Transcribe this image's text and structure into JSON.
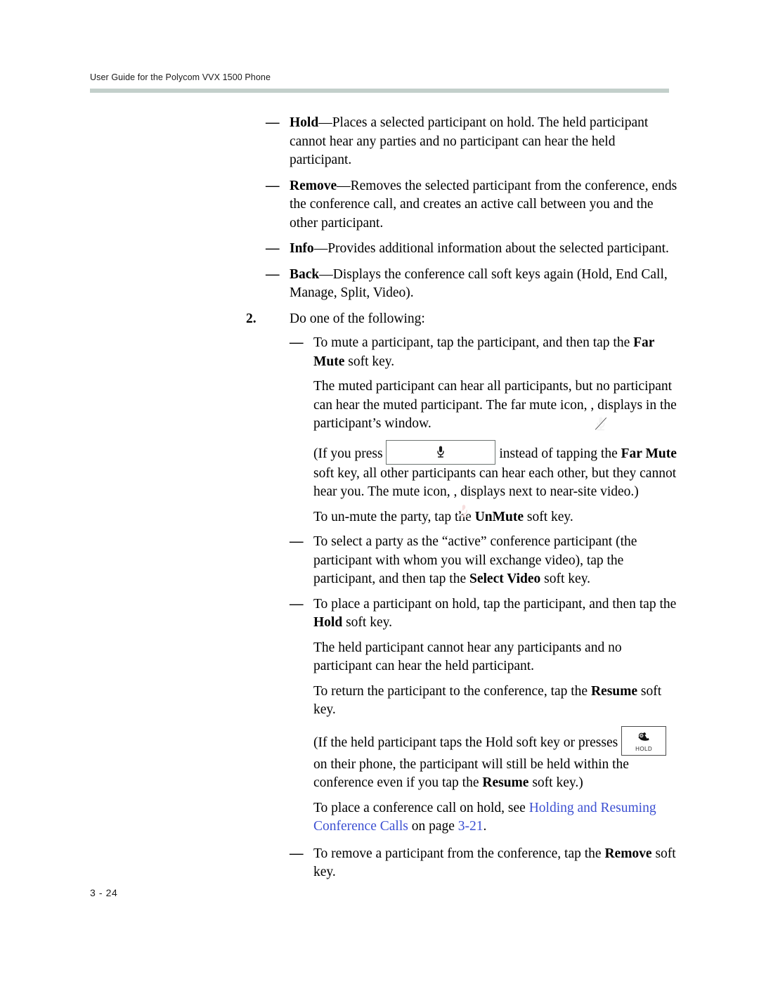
{
  "header": {
    "title": "User Guide for the Polycom VVX 1500 Phone"
  },
  "footer": {
    "page_number": "3 - 24"
  },
  "colors": {
    "header_rule": "#c3cfcb",
    "link": "#3c50d2",
    "far_mute_icon_bg": "#1b1b1b",
    "far_mute_icon_base": "#2e9b2e",
    "mute_icon_bg": "#e2121a"
  },
  "icons": {
    "far_mute": "far-mute-icon",
    "mute": "mute-icon",
    "mute_key": "mute-key-icon",
    "hold_key": "hold-key-icon",
    "hold_key_label": "HOLD"
  },
  "content": {
    "dash": "—",
    "bullets_top": [
      {
        "term": "Hold",
        "sep": "—",
        "text": "Places a selected participant on hold. The held participant cannot hear any parties and no participant can hear the held participant."
      },
      {
        "term": "Remove",
        "sep": "—",
        "text": "Removes the selected participant from the conference, ends the conference call, and creates an active call between you and the other participant."
      },
      {
        "term": "Info",
        "sep": "—",
        "text": "Provides additional information about the selected participant."
      },
      {
        "term": "Back",
        "sep": "—",
        "text": "Displays the conference call soft keys again (Hold, End Call, Manage, Split, Video)."
      }
    ],
    "step": {
      "number": "2.",
      "text": "Do one of the following:"
    },
    "mute_bullet": {
      "lead": "To mute a participant, tap the participant, and then tap the ",
      "bold": "Far Mute",
      "tail": " soft key."
    },
    "muted_para": {
      "part1": "The muted participant can hear all participants, but no participant can hear the muted participant. The far mute icon, ",
      "part2": ", displays in the participant’s window."
    },
    "press_para": {
      "part1": "(If you press ",
      "part2": " instead of tapping the ",
      "bold1": "Far Mute",
      "part3": " soft key, all other participants can hear each other, but they cannot hear you. The mute icon, ",
      "part4": ", displays next to near-site video.)"
    },
    "unmute_para": {
      "lead": "To un-mute the party, tap the ",
      "bold": "UnMute",
      "tail": " soft key."
    },
    "select_video_bullet": {
      "lead": "To select a party as the “active” conference participant (the participant with whom you will exchange video), tap the participant, and then tap the ",
      "bold": "Select Video",
      "tail": " soft key."
    },
    "hold_bullet": {
      "lead": "To place a participant on hold, tap the participant, and then tap the ",
      "bold": "Hold",
      "tail": " soft key."
    },
    "held_para": "The held participant cannot hear any participants and no participant can hear the held participant.",
    "resume_para": {
      "lead": "To return the participant to the conference, tap the ",
      "bold": "Resume",
      "tail": " soft key."
    },
    "hold_key_para": {
      "part1": "(If the held participant taps the Hold soft key or presses ",
      "part2": " on their phone, the participant will still be held within the conference even if you tap the ",
      "bold": "Resume",
      "part3": " soft key.)"
    },
    "cross_ref_para": {
      "lead": "To place a conference call on hold, see ",
      "link_text": "Holding and Resuming Conference Calls",
      "mid": " on page ",
      "link_page": "3-21",
      "tail": "."
    },
    "remove_bullet": {
      "lead": "To remove a participant from the conference, tap the ",
      "bold": "Remove",
      "tail": " soft key."
    }
  }
}
